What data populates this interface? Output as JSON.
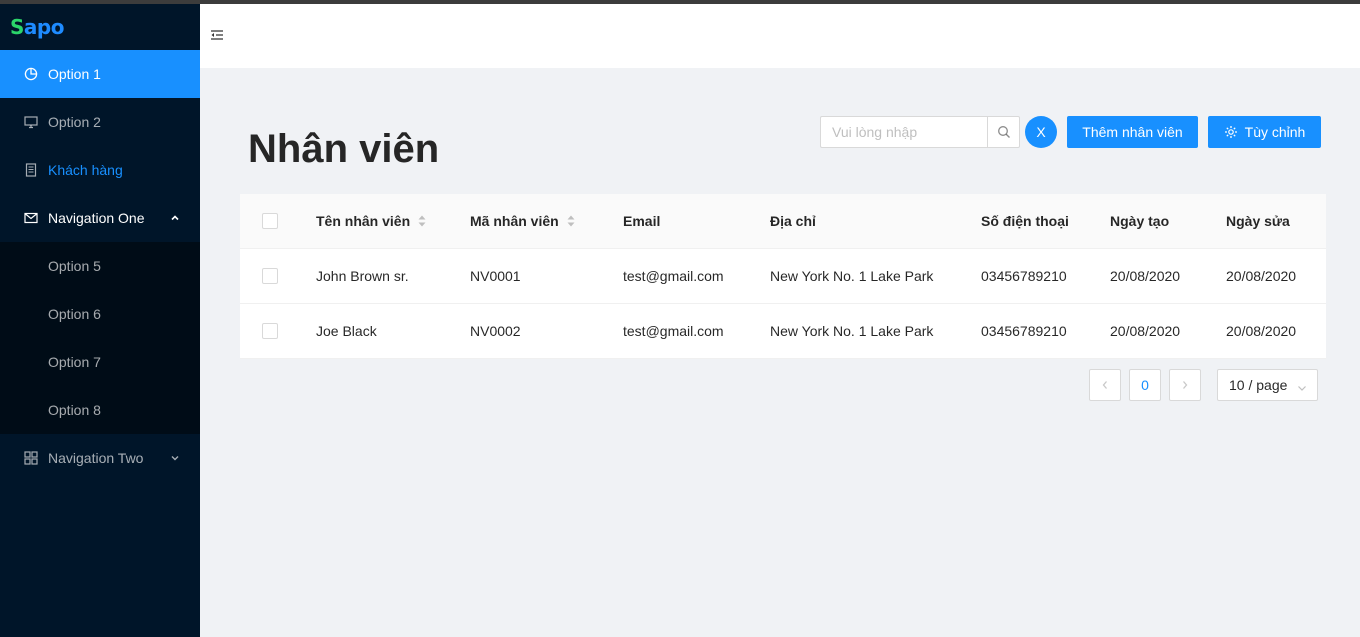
{
  "brand": {
    "logo_first": "S",
    "logo_rest": "apo",
    "colors": {
      "green": "#2bd56a",
      "blue": "#1e8bff"
    }
  },
  "sidebar": {
    "items": [
      {
        "label": "Option 1",
        "icon": "pie-chart-icon",
        "state": "active"
      },
      {
        "label": "Option 2",
        "icon": "desktop-icon",
        "state": "normal"
      },
      {
        "label": "Khách hàng",
        "icon": "file-icon",
        "state": "link"
      },
      {
        "label": "Navigation One",
        "icon": "mail-icon",
        "state": "open"
      },
      {
        "label": "Navigation Two",
        "icon": "appstore-icon",
        "state": "collapsed"
      }
    ],
    "submenu": [
      {
        "label": "Option 5"
      },
      {
        "label": "Option 6"
      },
      {
        "label": "Option 7"
      },
      {
        "label": "Option 8"
      }
    ]
  },
  "header": {
    "fold_icon": "menu-fold-icon"
  },
  "page": {
    "title": "Nhân viên"
  },
  "toolbar": {
    "search_placeholder": "Vui lòng nhập",
    "search_value": "",
    "clear_label": "X",
    "add_label": "Thêm nhân viên",
    "custom_label": "Tùy chỉnh"
  },
  "table": {
    "columns": [
      "Tên nhân viên",
      "Mã nhân viên",
      "Email",
      "Địa chỉ",
      "Số điện thoại",
      "Ngày tạo",
      "Ngày sửa"
    ],
    "rows": [
      [
        "John Brown sr.",
        "NV0001",
        "test@gmail.com",
        "New York No. 1 Lake Park",
        "03456789210",
        "20/08/2020",
        "20/08/2020"
      ],
      [
        "Joe Black",
        "NV0002",
        "test@gmail.com",
        "New York No. 1 Lake Park",
        "03456789210",
        "20/08/2020",
        "20/08/2020"
      ]
    ]
  },
  "pagination": {
    "current": "0",
    "page_size": "10 / page"
  },
  "colors": {
    "primary": "#1890ff",
    "sider": "#001529",
    "submenu": "#000c17",
    "content_bg": "#f0f2f5"
  }
}
